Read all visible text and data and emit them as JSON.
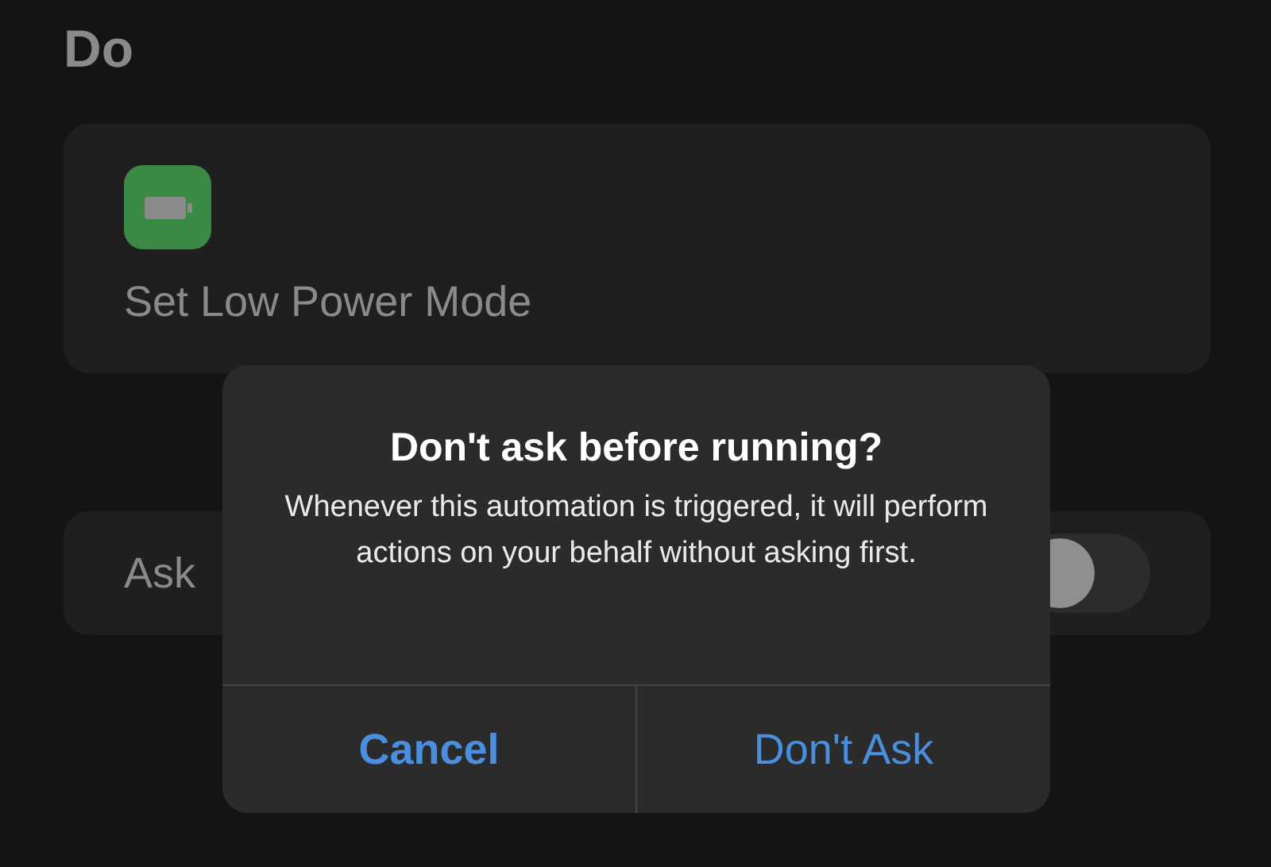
{
  "section_title": "Do",
  "action": {
    "label": "Set Low Power Mode"
  },
  "ask_row": {
    "label": "Ask",
    "on": false
  },
  "dialog": {
    "title": "Don't ask before running?",
    "message": "Whenever this automation is triggered, it will perform actions on your behalf without asking first.",
    "buttons": [
      {
        "label": "Cancel",
        "kind": "cancel"
      },
      {
        "label": "Don't Ask",
        "kind": "default"
      }
    ]
  }
}
